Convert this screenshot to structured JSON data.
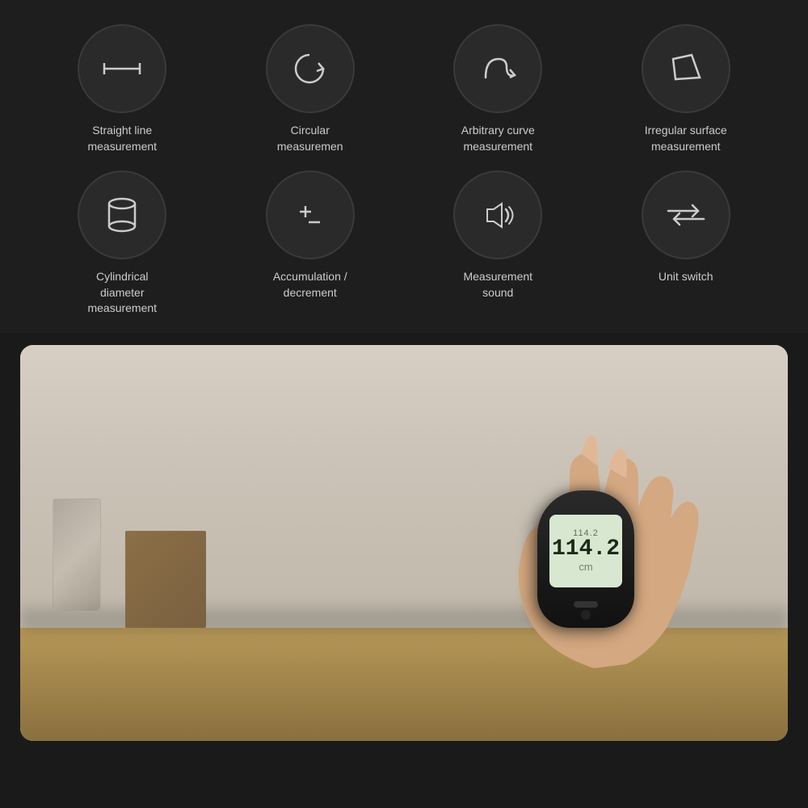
{
  "features": [
    {
      "id": "straight-line",
      "label": "Straight line\nmeasurement",
      "icon": "ruler"
    },
    {
      "id": "circular",
      "label": "Circular\nmeasuremen",
      "icon": "circular"
    },
    {
      "id": "arbitrary-curve",
      "label": "Arbitrary curve\nmeasurement",
      "icon": "curve"
    },
    {
      "id": "irregular-surface",
      "label": "Irregular surface\nmeasurement",
      "icon": "polygon"
    },
    {
      "id": "cylindrical",
      "label": "Cylindrical\ndiameter\nmeasurement",
      "icon": "cylinder"
    },
    {
      "id": "accumulation",
      "label": "Accumulation /\ndecrement",
      "icon": "plusminus"
    },
    {
      "id": "measurement-sound",
      "label": "Measurement\nsound",
      "icon": "sound"
    },
    {
      "id": "unit-switch",
      "label": "Unit switch",
      "icon": "switch"
    }
  ],
  "device": {
    "screen_top": "114.2",
    "screen_main": "114.2",
    "screen_unit": "cm"
  },
  "colors": {
    "background": "#1a1a1a",
    "circle_bg": "#2a2a2a",
    "icon_stroke": "#cccccc",
    "label_color": "#cccccc"
  }
}
